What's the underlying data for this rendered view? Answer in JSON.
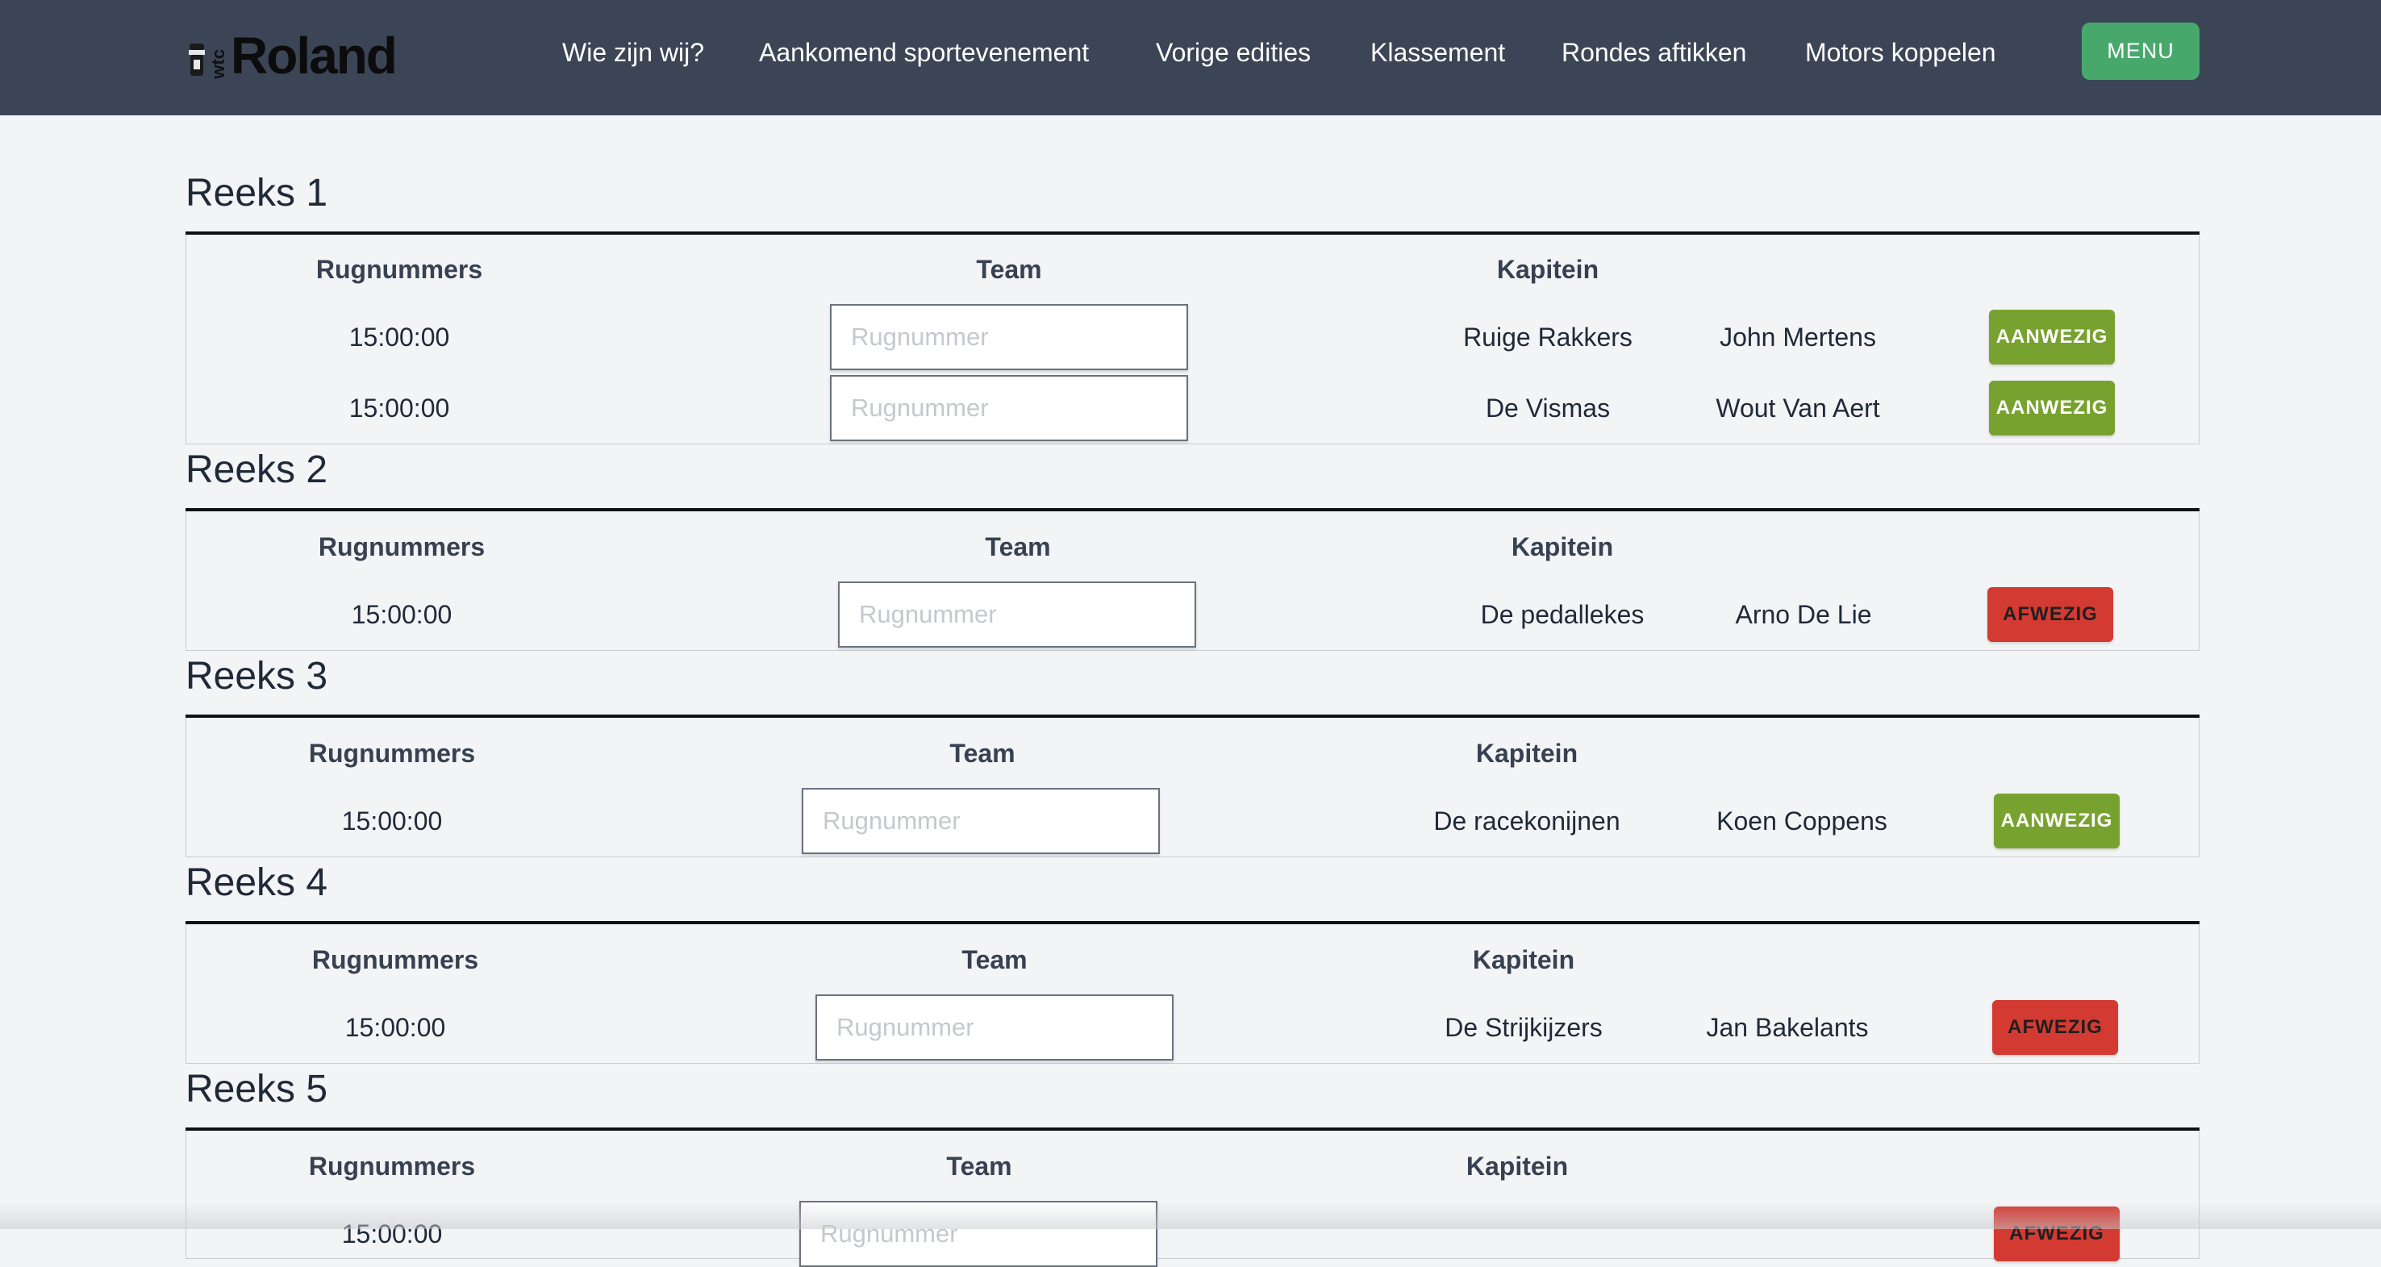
{
  "brand": {
    "small": "wtc",
    "name": "Roland"
  },
  "nav": {
    "links": [
      "Wie zijn wij?",
      "Aankomend sportevenement",
      "Vorige edities",
      "Klassement",
      "Rondes aftikken",
      "Motors koppelen"
    ],
    "menu_label": "MENU"
  },
  "columns": {
    "rugnummers": "Rugnummers",
    "team": "Team",
    "kapitein": "Kapitein"
  },
  "placeholder": "Rugnummer",
  "reeksen": [
    {
      "title": "Reeks 1",
      "rows": [
        {
          "time": "15:00:00",
          "team": "Ruige Rakkers",
          "captain": "John Mertens",
          "status": "AANWEZIG"
        },
        {
          "time": "15:00:00",
          "team": "De Vismas",
          "captain": "Wout Van Aert",
          "status": "AANWEZIG"
        }
      ]
    },
    {
      "title": "Reeks 2",
      "rows": [
        {
          "time": "15:00:00",
          "team": "De pedallekes",
          "captain": "Arno De Lie",
          "status": "AFWEZIG"
        }
      ]
    },
    {
      "title": "Reeks 3",
      "rows": [
        {
          "time": "15:00:00",
          "team": "De racekonijnen",
          "captain": "Koen Coppens",
          "status": "AANWEZIG"
        }
      ]
    },
    {
      "title": "Reeks 4",
      "rows": [
        {
          "time": "15:00:00",
          "team": "De Strijkijzers",
          "captain": "Jan Bakelants",
          "status": "AFWEZIG"
        }
      ]
    },
    {
      "title": "Reeks 5",
      "rows": [
        {
          "time": "15:00:00",
          "team": "",
          "captain": "",
          "status": "AFWEZIG"
        }
      ]
    }
  ],
  "colors": {
    "nav_bg": "#3b4556",
    "menu_btn": "#48a86b",
    "present": "#78a22f",
    "absent": "#d33a32"
  }
}
